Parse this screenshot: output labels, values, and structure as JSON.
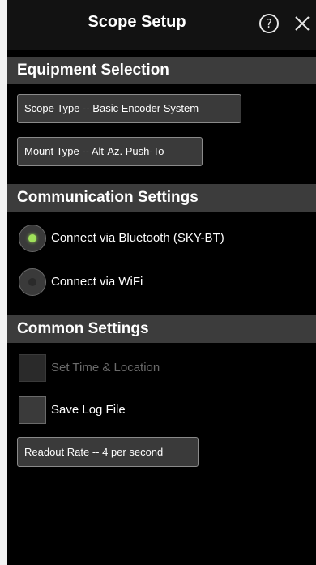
{
  "header": {
    "title": "Scope Setup",
    "help_icon": "?"
  },
  "sections": {
    "equipment": {
      "title": "Equipment Selection",
      "scope_type_label": "Scope Type -- Basic Encoder System",
      "mount_type_label": "Mount Type -- Alt-Az. Push-To"
    },
    "communication": {
      "title": "Communication Settings",
      "bluetooth_label": "Connect via Bluetooth (SKY-BT)",
      "bluetooth_selected": true,
      "wifi_label": "Connect via WiFi",
      "wifi_selected": false
    },
    "common": {
      "title": "Common Settings",
      "set_time_label": "Set Time & Location",
      "set_time_enabled": false,
      "save_log_label": "Save Log File",
      "save_log_checked": false,
      "readout_rate_label": "Readout Rate -- 4 per second"
    }
  },
  "colors": {
    "background": "#000000",
    "header_bg": "#3c3c3c",
    "radio_active": "#9fe05a",
    "disabled_text": "#6a6a6a"
  }
}
